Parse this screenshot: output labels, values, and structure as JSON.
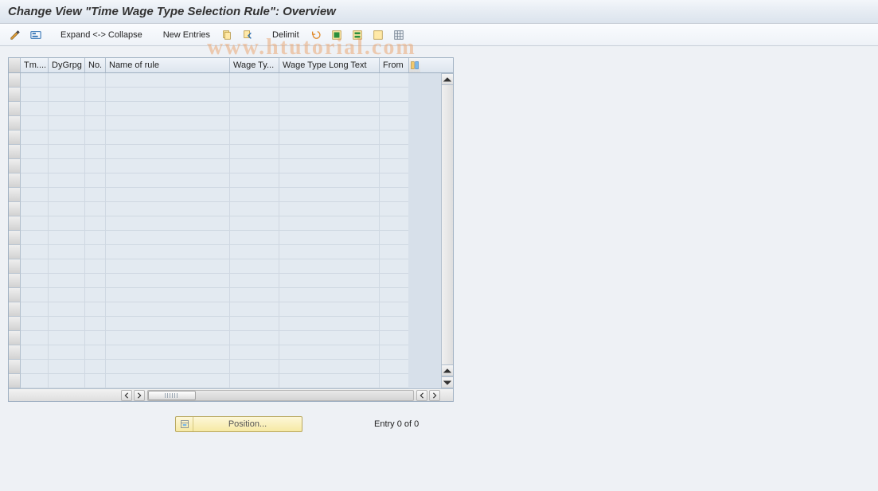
{
  "title": "Change View \"Time Wage Type Selection Rule\": Overview",
  "toolbar": {
    "expand_collapse": "Expand <-> Collapse",
    "new_entries": "New Entries",
    "delimit": "Delimit"
  },
  "columns": {
    "tm": "Tm....",
    "dy": "DyGrpg",
    "no": "No.",
    "name": "Name of rule",
    "wt": "Wage Ty...",
    "wtl": "Wage Type Long Text",
    "from": "From"
  },
  "footer": {
    "position": "Position...",
    "entry_text": "Entry 0 of 0"
  },
  "watermark": "www.htutorial.com",
  "row_count": 22,
  "rows": []
}
